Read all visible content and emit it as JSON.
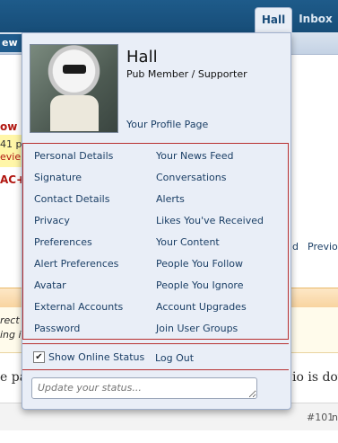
{
  "nav": {
    "new_label": "ew",
    "tab_hall": "Hall",
    "tab_inbox": "Inbox"
  },
  "background": {
    "red_fragment_1": "ow",
    "yellow_fragment_1": "41 p",
    "yellow_fragment_2": "evie",
    "red_fragment_2": "AC+",
    "link_fragment": "d",
    "link_previous": "Previo",
    "italic_fragment_1": "rect",
    "italic_fragment_2": "ing i",
    "body_left": "e pa",
    "body_right": "io is dov",
    "post_number": "#101",
    "post_right": "n"
  },
  "profile": {
    "name": "Hall",
    "title": "Pub Member / Supporter",
    "profile_link": "Your Profile Page"
  },
  "menu": {
    "left": [
      "Personal Details",
      "Signature",
      "Contact Details",
      "Privacy",
      "Preferences",
      "Alert Preferences",
      "Avatar",
      "External Accounts",
      "Password"
    ],
    "right": [
      "Your News Feed",
      "Conversations",
      "Alerts",
      "Likes You've Received",
      "Your Content",
      "People You Follow",
      "People You Ignore",
      "Account Upgrades",
      "Join User Groups"
    ]
  },
  "footer": {
    "online_status_label": "Show Online Status",
    "online_status_checked": true,
    "logout_label": "Log Out",
    "status_placeholder": "Update your status..."
  },
  "colors": {
    "top_bar": "#1e5b8a",
    "popup_bg": "#e9eef7",
    "link": "#1b3f66",
    "highlight_border": "#b83030"
  }
}
